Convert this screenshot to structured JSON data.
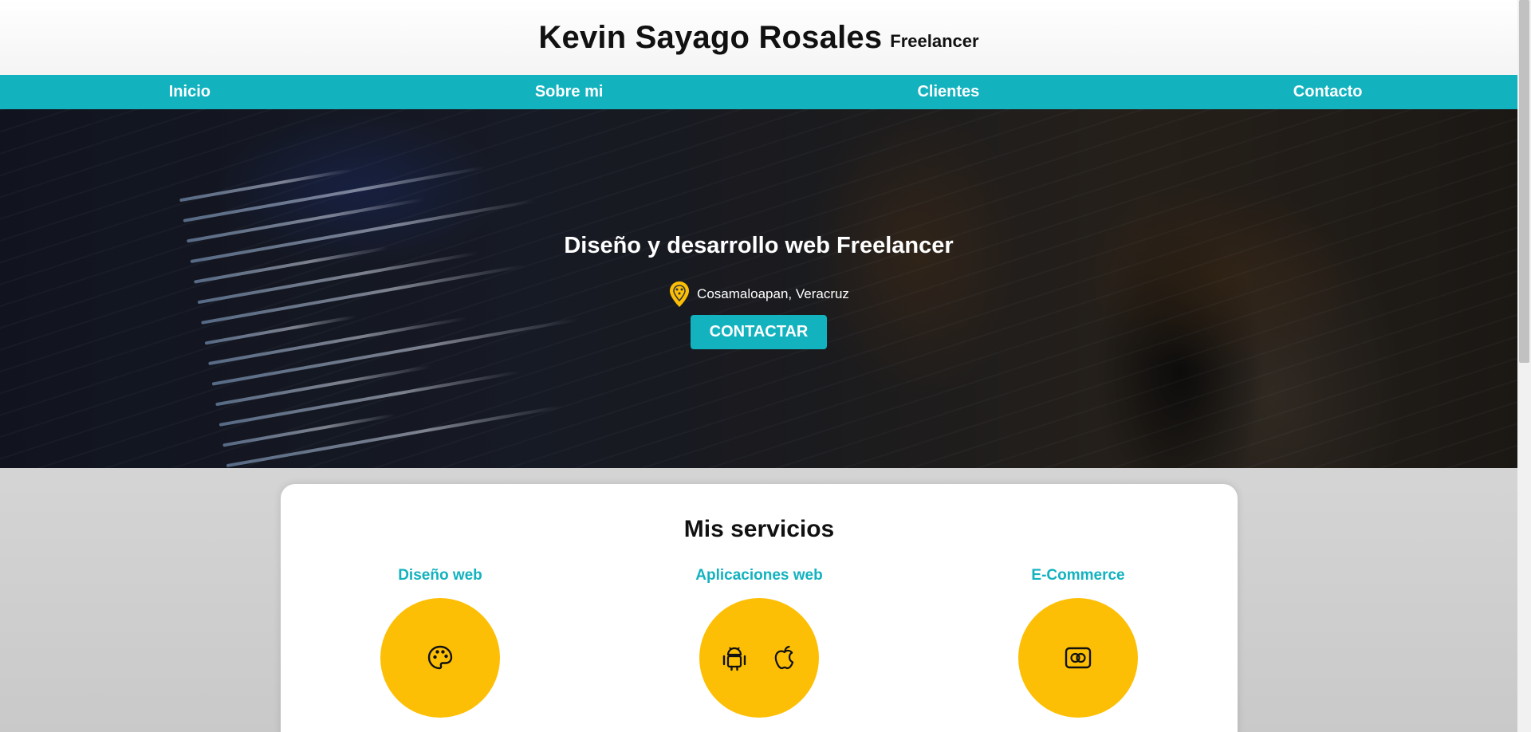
{
  "header": {
    "title": "Kevin Sayago Rosales",
    "subtitle": "Freelancer"
  },
  "nav": {
    "items": [
      "Inicio",
      "Sobre mi",
      "Clientes",
      "Contacto"
    ]
  },
  "hero": {
    "title": "Diseño y desarrollo web Freelancer",
    "location": "Cosamaloapan, Veracruz",
    "cta_label": "CONTACTAR"
  },
  "services": {
    "title": "Mis servicios",
    "items": [
      {
        "label": "Diseño web",
        "icons": [
          "palette-icon"
        ]
      },
      {
        "label": "Aplicaciones web",
        "icons": [
          "android-icon",
          "apple-icon"
        ]
      },
      {
        "label": "E-Commerce",
        "icons": [
          "credit-card-icon"
        ]
      }
    ]
  },
  "colors": {
    "accent": "#12b2bf",
    "yellow": "#fdbf05",
    "white": "#ffffff"
  }
}
